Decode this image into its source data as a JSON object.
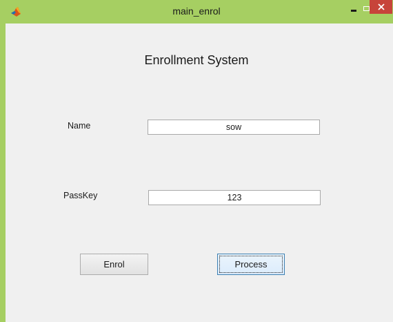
{
  "window": {
    "title": "main_enrol",
    "icon": "matlab-logo-icon",
    "colors": {
      "titlebar": "#a6cf62",
      "close": "#c7443a",
      "client": "#f0f0f0"
    }
  },
  "form": {
    "heading": "Enrollment System",
    "name": {
      "label": "Name",
      "value": "sow"
    },
    "passkey": {
      "label": "PassKey",
      "value": "123"
    }
  },
  "buttons": {
    "enrol": "Enrol",
    "process": "Process"
  }
}
